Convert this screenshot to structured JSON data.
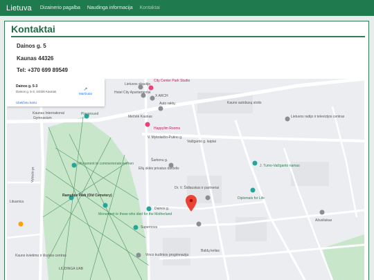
{
  "nav": {
    "brand": "Lietuva",
    "items": [
      {
        "label": "Dizainerio pagalba"
      },
      {
        "label": "Naudinga informacija"
      },
      {
        "label": "Kontaktai"
      }
    ]
  },
  "contact": {
    "title": "Kontaktai",
    "street": "Dainos g. 5",
    "city": "Kaunas 44326",
    "phone": "Tel: +370 699 89549"
  },
  "map": {
    "info_name": "Dainos g. 5-3",
    "info_address": "Dainos g. 5-3, 44326 Kaunas",
    "directions": "Maršrutai",
    "larger_map": "Ubeličetu kartu",
    "labels": {
      "lietuvos_sk": "Lietuvos skautija",
      "hotel_apt": "Hotel City Apartamentai",
      "city_center": "City Center Park Studio",
      "xarch": "X ARCH",
      "auto_raktu": "Auto raktų",
      "kaunas_intl": "Kaunas International",
      "gymnasium": "Gymnasium",
      "playground": "Playground",
      "meciete": "Mečetė Kaunas",
      "happylim": "Happylim Rooms",
      "mykolaicio": "V. Mykolaičio-Putino g.",
      "vaizganto": "Vaižganto g. laiptai",
      "kauno_stotis": "Kauno autobusų stotis",
      "lrt": "Lietuvos radijo ir televizijos centras",
      "monument1": "Monument to commemorate women",
      "sarkonu": "Šarkonu g.",
      "ellu": "Ellų sklės privatus darželis",
      "tumo": "J. Tumo-Vaižganto namas",
      "ramybes": "Ramybės Park (Old Cemetery)",
      "dr_sidlauskas": "Dr. V. Šidlauskas ir partneriai",
      "diplomats": "Diplomats for Life",
      "monument2": "Monument to those who died for the Motherland",
      "dainos": "Dainos g.",
      "supernova": "Supernova",
      "azuoliukas": "Ažuoliukas",
      "baldu": "Baldų kelias",
      "vinco": "Vinco kudirkos progimnazija",
      "kauno_kvietimo": "Kauno kvietimo ir išvykos centras",
      "liudinga": "LIŪDINGA UAB",
      "lituanika": "Lituanica",
      "vytauto": "Vytauto pr."
    },
    "colors": {
      "park": "#c8e6c9",
      "road": "#ffffff",
      "pin": "#ea4335",
      "poi_teal": "#26a69a",
      "poi_grey": "#8a8f94"
    }
  }
}
